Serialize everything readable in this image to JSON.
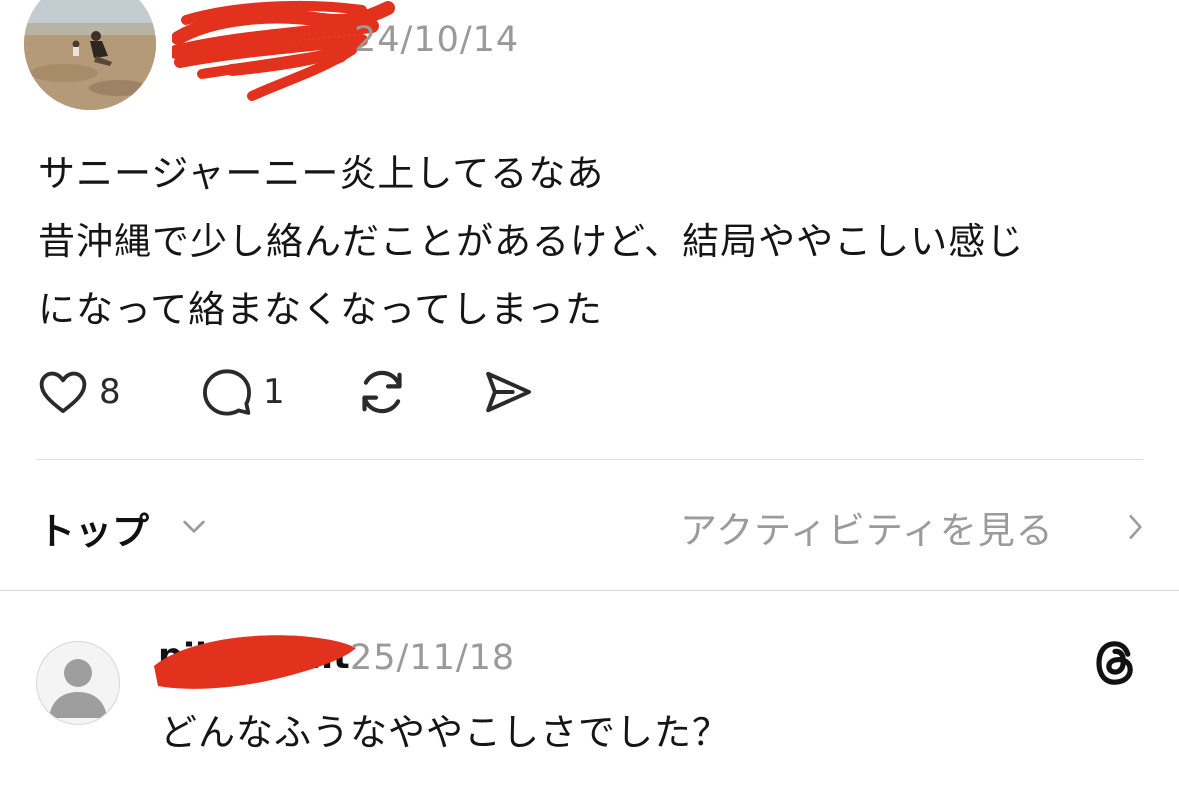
{
  "post": {
    "avatar_icon": "beach-photo-avatar",
    "date": "24/10/14",
    "body_lines": [
      "サニージャーニー炎上してるなあ",
      "昔沖縄で少し絡んだことがあるけど、結局ややこしい感じ",
      "になって絡まなくなってしまった"
    ],
    "actions": {
      "like_icon": "heart-icon",
      "like_count": "8",
      "reply_icon": "speech-bubble-icon",
      "reply_count": "1",
      "repost_icon": "repost-icon",
      "share_icon": "send-icon"
    }
  },
  "sort_bar": {
    "label": "トップ",
    "chevron_icon": "chevron-down-icon",
    "activity_link": "アクティビティを見る",
    "activity_chevron_icon": "chevron-right-icon"
  },
  "reply": {
    "avatar_icon": "default-user-avatar",
    "username": "pilot21mt",
    "date": "25/11/18",
    "text": "どんなふうなややこしさでした？",
    "threads_icon": "threads-logo-icon"
  },
  "colors": {
    "redaction": "#e2311c",
    "muted_text": "#9a9a9a",
    "divider": "#d9d9d9"
  }
}
